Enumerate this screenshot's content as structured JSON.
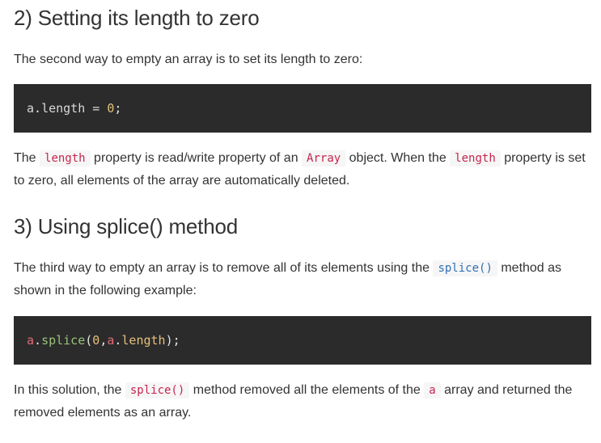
{
  "section2": {
    "heading": "2) Setting its length to zero",
    "intro": "The second way to empty an array is to set its length to zero:",
    "code": {
      "obj": "a",
      "dot": ".",
      "prop": "length",
      "op": " = ",
      "num": "0",
      "end": ";"
    },
    "para": {
      "t1": "The ",
      "c1": "length",
      "t2": " property is read/write property of an ",
      "c2": "Array",
      "t3": " object. When the ",
      "c3": "length",
      "t4": " property is set to zero, all elements of the array are automatically deleted."
    }
  },
  "section3": {
    "heading": "3) Using splice() method",
    "intro": {
      "t1": "The third way to empty an array is to remove all of its elements using the ",
      "c1": "splice()",
      "t2": " method as shown in the following example:"
    },
    "code": {
      "obj": "a",
      "dot": ".",
      "fn": "splice",
      "open": "(",
      "num": "0",
      "comma": ",",
      "obj2": "a",
      "dot2": ".",
      "prop": "length",
      "close": ");"
    },
    "para": {
      "t1": "In this solution, the ",
      "c1": "splice()",
      "t2": " method removed all the elements of the ",
      "c2": "a",
      "t3": " array and returned the removed elements as an array."
    }
  }
}
